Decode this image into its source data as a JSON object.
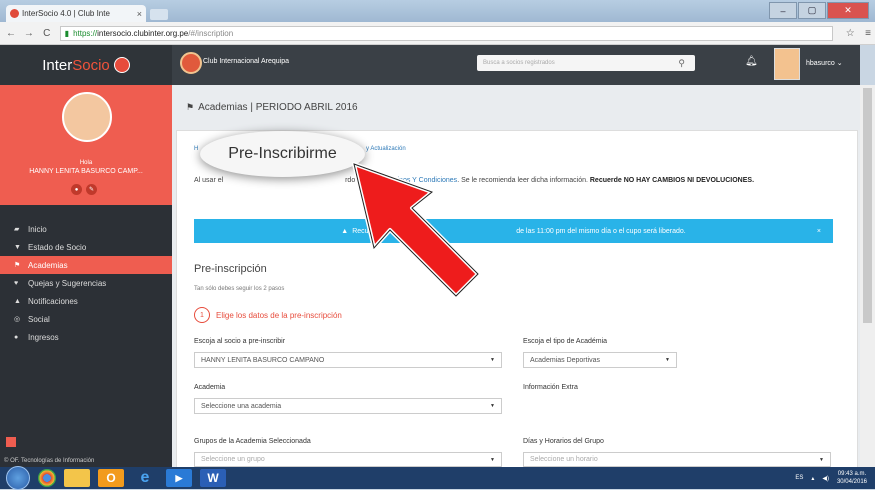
{
  "browser": {
    "tab_title": "InterSocio 4.0 | Club Inte",
    "tab_close": "×",
    "url_secure": "https://",
    "url_host": "intersocio.clubinter.org.pe",
    "url_path": "/#/inscription",
    "nav_back": "←",
    "nav_forward": "→",
    "reload": "C",
    "star": "☆",
    "menu": "≡"
  },
  "header": {
    "logo_inter": "Inter",
    "logo_socio": "Socio",
    "club_name": "Club Internacional Arequipa",
    "search_placeholder": "Busca a socios registrados",
    "username": "hbasurco"
  },
  "sidebar": {
    "greeting": "Hola",
    "full_name": "HANNY LENITA BASURCO CAMP...",
    "items": [
      {
        "label": "Inicio",
        "icon": "▰"
      },
      {
        "label": "Estado de Socio",
        "icon": "▼"
      },
      {
        "label": "Academias",
        "icon": "⚑"
      },
      {
        "label": "Quejas y Sugerencias",
        "icon": "♥"
      },
      {
        "label": "Notificaciones",
        "icon": "▲"
      },
      {
        "label": "Social",
        "icon": "◎"
      },
      {
        "label": "Ingresos",
        "icon": "●"
      }
    ],
    "footer": "© OF. Tecnologías de Información"
  },
  "main": {
    "breadcrumb": "Academias | PERIODO ABRIL 2016",
    "tab_first": "H",
    "tab_second": "y Actualización",
    "notice_prefix": "Al usar el",
    "notice_mid": "rdo con los",
    "notice_link": "Términos Y Condiciones",
    "notice_rest": ". Se le recomienda leer dicha información.",
    "notice_bold": "Recuerde NO HAY CAMBIOS NI DEVOLUCIONES.",
    "alert_left": "Recuerda que",
    "alert_right": "de las 11:00 pm del mismo día o el cupo será liberado.",
    "alert_close": "×",
    "section_title": "Pre-inscripción",
    "steps_note": "Tan sólo debes seguir los 2 pasos",
    "step1_num": "1",
    "step1_label": "Elige los datos de la pre-inscripción",
    "label_socio": "Escoja al socio a pre-inscribir",
    "value_socio": "HANNY LENITA BASURCO CAMPANO",
    "label_tipo": "Escoja el tipo de Académia",
    "value_tipo": "Academias Deportivas",
    "label_academia": "Academia",
    "value_academia": "Seleccione una academia",
    "label_extra": "Información Extra",
    "label_grupos": "Grupos de la Academia Seleccionada",
    "value_grupos": "Seleccione un grupo",
    "label_dias": "Días y Horarios del Grupo",
    "value_dias": "Seleccione un horario",
    "popup_label": "Pre-Inscribirme"
  },
  "taskbar": {
    "lang": "ES",
    "time": "09:43 a.m.",
    "date": "30/04/2016"
  },
  "colors": {
    "accent": "#ef5d50",
    "alert": "#29b3e8",
    "arrow": "#ee1c1c"
  }
}
